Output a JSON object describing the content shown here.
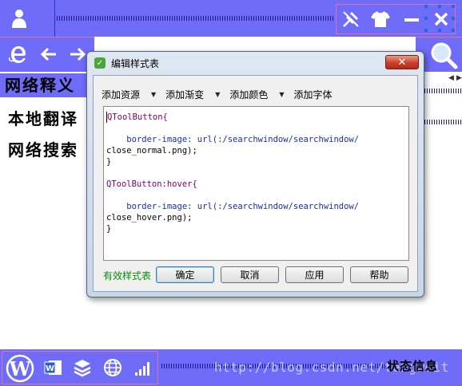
{
  "colors": {
    "bar_background": "#6e6cf8",
    "highlight_border": "#e070a0",
    "valid_text": "#0a8a0a"
  },
  "top_bar": {
    "icons": [
      "user-icon",
      "pin-icon",
      "shirt-icon",
      "minimize-icon",
      "close-icon"
    ]
  },
  "nav_bar": {
    "icons": [
      "ie-icon",
      "back-arrow-icon",
      "forward-arrow-icon",
      "search-icon"
    ]
  },
  "side_menu": {
    "items": [
      {
        "label": "网络释义"
      },
      {
        "label": "本地翻译"
      },
      {
        "label": "网络搜索"
      }
    ]
  },
  "dialog": {
    "title": "编辑样式表",
    "close_glyph": "✕",
    "menu": [
      {
        "label": "添加资源"
      },
      {
        "label": "添加渐变"
      },
      {
        "label": "添加颜色"
      },
      {
        "label": "添加字体"
      }
    ],
    "editor_lines": [
      "QToolButton{",
      "",
      "    border-image: url(:/searchwindow/searchwindow/",
      "close_normal.png);",
      "}",
      "",
      "QToolButton:hover{",
      "",
      "    border-image: url(:/searchwindow/searchwindow/",
      "close_hover.png);",
      "}"
    ],
    "status": "有效样式表",
    "buttons": {
      "ok": "确定",
      "cancel": "取消",
      "apply": "应用",
      "help": "帮助"
    }
  },
  "bottom_bar": {
    "icons": [
      "wordpress-icon",
      "word-icon",
      "layers-icon",
      "globe-icon",
      "signal-icon"
    ],
    "word_letter": "W",
    "status_text": "状态信息",
    "watermark": "http://blog.csdn.net/tengweit"
  }
}
